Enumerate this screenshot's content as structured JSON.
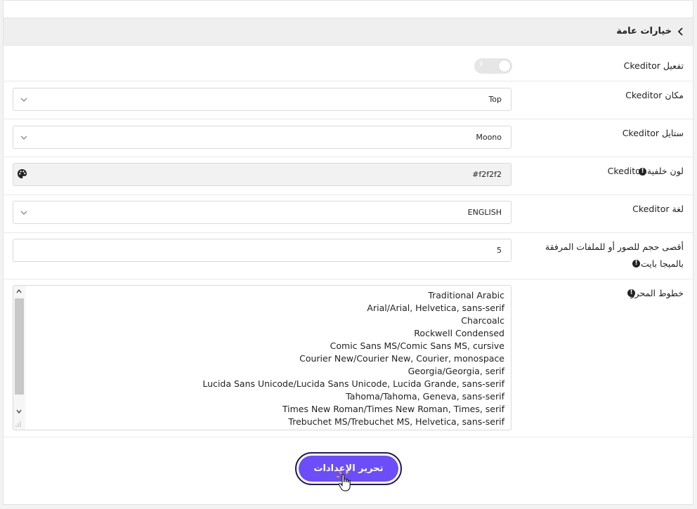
{
  "panel": {
    "title": "خيارات عامة"
  },
  "rows": {
    "enable": {
      "label": "تفعيل Ckeditor",
      "toggle_text": "لا"
    },
    "position": {
      "label": "مكان Ckeditor",
      "value": "Top"
    },
    "style": {
      "label": "ستايل Ckeditor",
      "value": "Moono"
    },
    "bgcolor": {
      "label": "لون خلفية Ckeditor",
      "value": "#f2f2f2"
    },
    "language": {
      "label": "لغة Ckeditor",
      "value": "ENGLISH"
    },
    "maxsize": {
      "label_line1": "أقصى حجم للصور أو للملفات المرفقة",
      "label_line2": "بالميجا بايت",
      "value": "5"
    },
    "fonts": {
      "label": "خطوط المحرر",
      "items": [
        "Traditional Arabic",
        "Arial/Arial, Helvetica, sans-serif",
        "Charcoalc",
        "Rockwell Condensed",
        "Comic Sans MS/Comic Sans MS, cursive",
        "Courier New/Courier New, Courier, monospace",
        "Georgia/Georgia, serif",
        "Lucida Sans Unicode/Lucida Sans Unicode, Lucida Grande, sans-serif",
        "Tahoma/Tahoma, Geneva, sans-serif",
        "Times New Roman/Times New Roman, Times, serif",
        "Trebuchet MS/Trebuchet MS, Helvetica, sans-serif"
      ]
    }
  },
  "save_button": "تحرير الإعدادات",
  "colors": {
    "accent": "#6c4dfa",
    "button_ring": "#1e1b5e",
    "header_bg": "#efefef"
  },
  "icons": [
    "chevron-left-icon",
    "chevron-down-icon",
    "palette-icon",
    "info-icon",
    "hand-cursor-icon"
  ]
}
